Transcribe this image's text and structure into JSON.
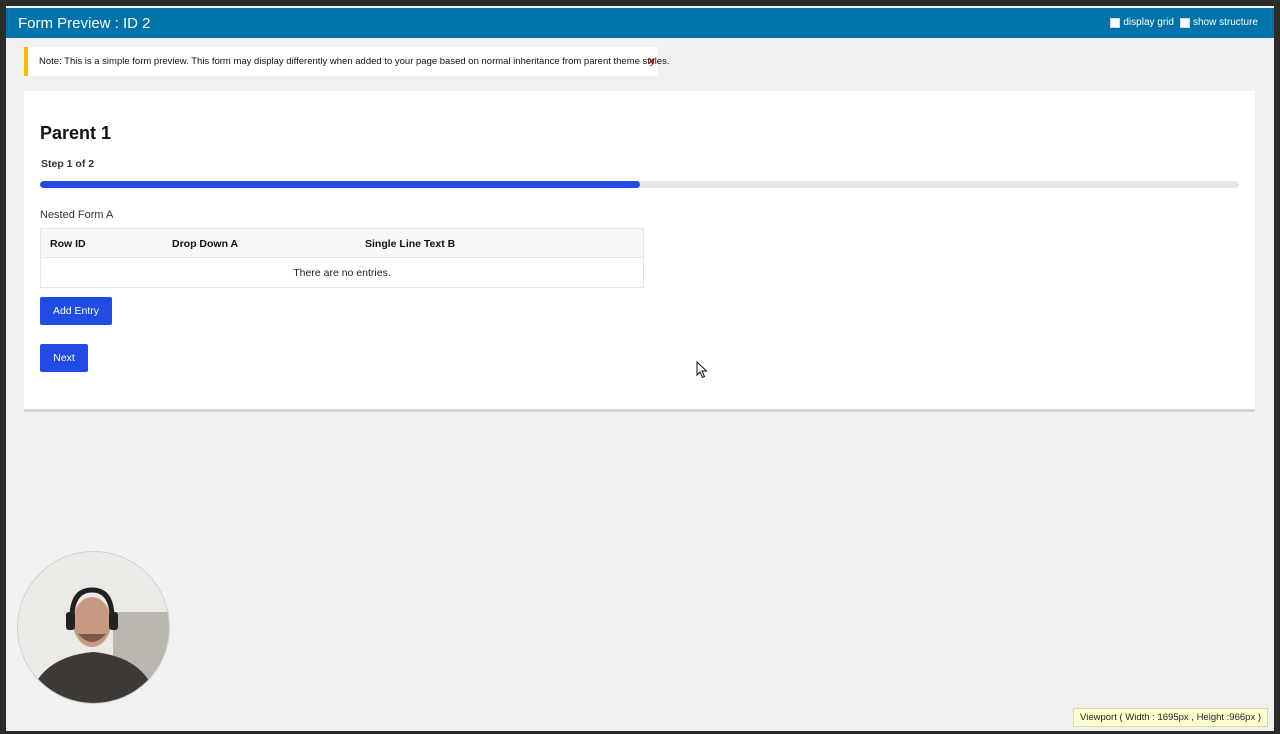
{
  "header": {
    "title": "Form Preview : ID 2",
    "options": {
      "display_grid": "display grid",
      "show_structure": "show structure"
    }
  },
  "notice": {
    "text": "Note: This is a simple form preview. This form may display differently when added to your page based on normal inheritance from parent theme styles.",
    "close_glyph": "×"
  },
  "form": {
    "title": "Parent 1",
    "step": "Step 1 of 2",
    "progress_percent": 50,
    "nested_label": "Nested Form A",
    "table": {
      "columns": [
        "Row ID",
        "Drop Down A",
        "Single Line Text B"
      ],
      "empty_text": "There are no entries."
    },
    "add_entry_label": "Add Entry",
    "next_label": "Next"
  },
  "viewport_badge": "Viewport ( Width : 1695px , Height :966px )",
  "colors": {
    "header_bg": "#0073aa",
    "button_bg": "#204ce5",
    "progress_fill": "#204ce5",
    "notice_accent": "#ffba00"
  }
}
